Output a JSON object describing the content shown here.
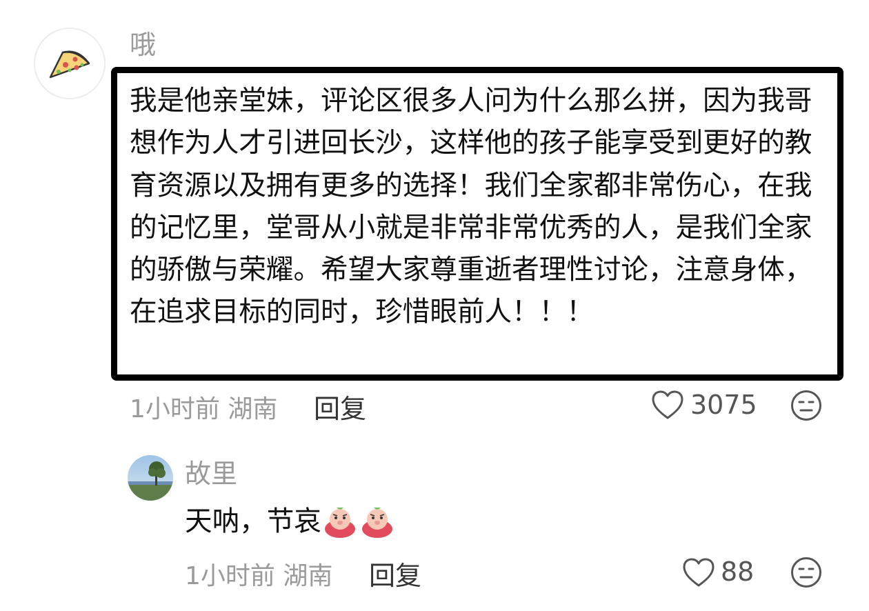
{
  "comment": {
    "username": "哦",
    "avatar_icon": "pizza-slice-icon",
    "text": "我是他亲堂妹，评论区很多人问为什么那么拼，因为我哥想作为人才引进回长沙，这样他的孩子能享受到更好的教育资源以及拥有更多的选择！我们全家都非常伤心，在我的记忆里，堂哥从小就是非常非常优秀的人，是我们全家的骄傲与荣耀。希望大家尊重逝者理性讨论，注意身体，在追求目标的同时，珍惜眼前人！！！",
    "meta": "1小时前 湖南",
    "reply_label": "回复",
    "like_count": "3075",
    "like_icon": "heart-outline-icon",
    "dislike_icon": "meh-face-icon",
    "highlight_color": "#000000"
  },
  "reply": {
    "username": "故里",
    "avatar_icon": "landscape-tree-avatar",
    "text": "天呐，节哀",
    "emojis": [
      "sad-pig-emoji",
      "sad-pig-emoji"
    ],
    "meta": "1小时前 湖南",
    "reply_label": "回复",
    "like_count": "88",
    "like_icon": "heart-outline-icon",
    "dislike_icon": "meh-face-icon"
  }
}
